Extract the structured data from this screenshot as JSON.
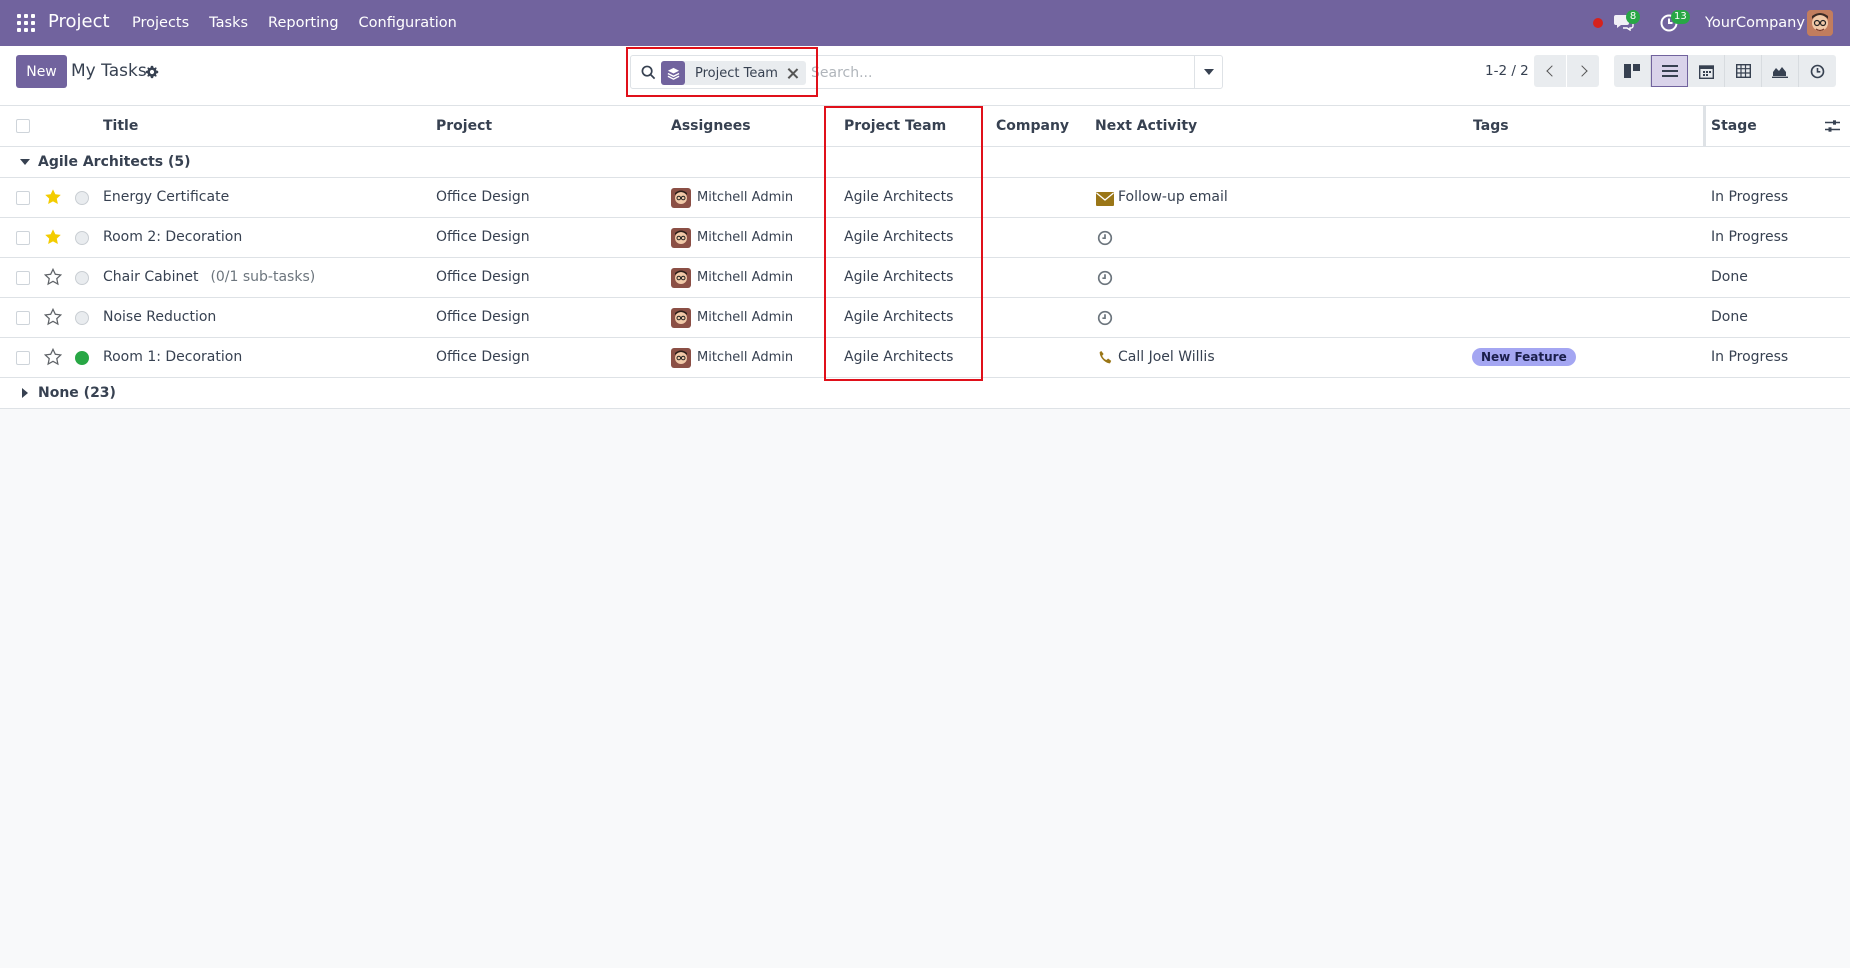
{
  "navbar": {
    "brand": "Project",
    "menu": [
      "Projects",
      "Tasks",
      "Reporting",
      "Configuration"
    ],
    "chat_badge": "8",
    "activity_badge": "13",
    "company": "YourCompany"
  },
  "control_panel": {
    "new_label": "New",
    "title": "My Tasks",
    "search": {
      "facet_label": "Project Team",
      "placeholder": "Search..."
    },
    "pager": "1-2 / 2"
  },
  "list": {
    "columns": {
      "title": "Title",
      "project": "Project",
      "assignees": "Assignees",
      "project_team": "Project Team",
      "company": "Company",
      "next_activity": "Next Activity",
      "tags": "Tags",
      "stage": "Stage"
    },
    "groups": [
      {
        "label": "Agile Architects (5)",
        "rows": [
          {
            "title": "Energy Certificate",
            "subtasks": "",
            "starred": true,
            "state": "normal",
            "project": "Office Design",
            "assignee": "Mitchell Admin",
            "team": "Agile Architects",
            "activity_icon": "envelope-icon",
            "activity": "Follow-up email",
            "tag": "",
            "stage": "In Progress"
          },
          {
            "title": "Room 2: Decoration",
            "subtasks": "",
            "starred": true,
            "state": "normal",
            "project": "Office Design",
            "assignee": "Mitchell Admin",
            "team": "Agile Architects",
            "activity_icon": "clock-icon",
            "activity": "",
            "tag": "",
            "stage": "In Progress"
          },
          {
            "title": "Chair Cabinet",
            "subtasks": "(0/1 sub-tasks)",
            "starred": false,
            "state": "normal",
            "project": "Office Design",
            "assignee": "Mitchell Admin",
            "team": "Agile Architects",
            "activity_icon": "clock-icon",
            "activity": "",
            "tag": "",
            "stage": "Done"
          },
          {
            "title": "Noise Reduction",
            "subtasks": "",
            "starred": false,
            "state": "normal",
            "project": "Office Design",
            "assignee": "Mitchell Admin",
            "team": "Agile Architects",
            "activity_icon": "clock-icon",
            "activity": "",
            "tag": "",
            "stage": "Done"
          },
          {
            "title": "Room 1: Decoration",
            "subtasks": "",
            "starred": false,
            "state": "done",
            "project": "Office Design",
            "assignee": "Mitchell Admin",
            "team": "Agile Architects",
            "activity_icon": "phone-icon",
            "activity": "Call Joel Willis",
            "tag": "New Feature",
            "stage": "In Progress"
          }
        ]
      },
      {
        "label": "None (23)",
        "rows": []
      }
    ]
  },
  "colors": {
    "brand": "#71639e",
    "star_active": "#f3cc00",
    "state_done": "#28a745",
    "tag_new_feature": "#a4a6f2",
    "activity_icon": "#9a7617",
    "highlight": "#e0101a"
  }
}
